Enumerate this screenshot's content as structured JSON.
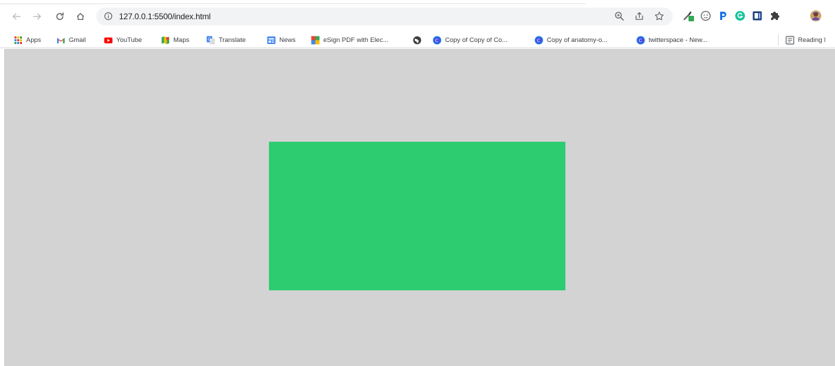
{
  "browser": {
    "url": "127.0.0.1:5500/index.html",
    "toolbar_icons": [
      "back-icon",
      "forward-icon",
      "reload-icon",
      "home-icon",
      "site-info-icon",
      "zoom-icon",
      "share-icon",
      "bookmark-star-icon"
    ],
    "extensions": [
      "eyedropper-extension-icon",
      "smiley-extension-icon",
      "p-extension-icon",
      "grammarly-extension-icon",
      "panel-extension-icon",
      "puzzle-extensions-icon",
      "profile-avatar"
    ]
  },
  "bookmarks": [
    {
      "label": "Apps",
      "icon": "apps-grid-icon"
    },
    {
      "label": "Gmail",
      "icon": "gmail-icon"
    },
    {
      "label": "YouTube",
      "icon": "youtube-icon"
    },
    {
      "label": "Maps",
      "icon": "maps-icon"
    },
    {
      "label": "Translate",
      "icon": "translate-icon"
    },
    {
      "label": "News",
      "icon": "news-icon"
    },
    {
      "label": "eSign PDF with Elec...",
      "icon": "esign-icon"
    },
    {
      "label": "",
      "icon": "globe-icon"
    },
    {
      "label": "Copy of Copy of Co...",
      "icon": "canva-icon"
    },
    {
      "label": "Copy of anatomy-o...",
      "icon": "canva-icon"
    },
    {
      "label": "twitterspace - New...",
      "icon": "canva-icon"
    },
    {
      "label": "Reading l",
      "icon": "reading-list-icon"
    }
  ],
  "page": {
    "background": "#d3d3d3",
    "box_color": "#2ecc71"
  }
}
